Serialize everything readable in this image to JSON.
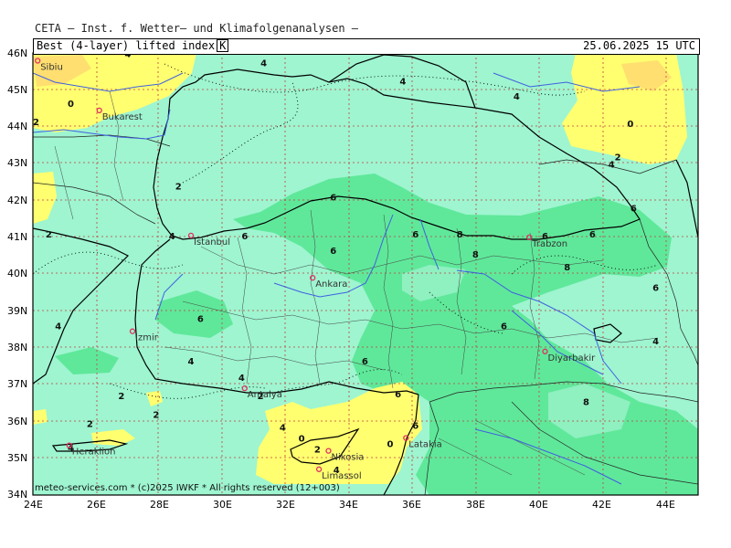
{
  "header": {
    "model_title": "CETA — Inst. f. Wetter— und Klimafolgenanalysen —",
    "parameter": "Best (4-layer) lifted index",
    "unit": "K",
    "datetime": "25.06.2025 15 UTC"
  },
  "footer": {
    "credit": "meteo-services.com * (c)2025 IWKF * All rights reserved (12+003)"
  },
  "colors": {
    "ocean_fill": "#9ef5d0",
    "lifted_green": "#5fe89a",
    "lifted_yellow": "#ffff70",
    "lifted_orange": "#ffdf70",
    "coast_line": "#000000",
    "river_line": "#4060e0",
    "grid_line": "#c04040",
    "city_marker": "#e03060"
  },
  "axes": {
    "lat_labels": [
      "46N",
      "45N",
      "44N",
      "43N",
      "42N",
      "41N",
      "40N",
      "39N",
      "38N",
      "37N",
      "36N",
      "35N",
      "34N"
    ],
    "lon_labels": [
      "24E",
      "26E",
      "28E",
      "30E",
      "32E",
      "34E",
      "36E",
      "38E",
      "40E",
      "42E",
      "44E"
    ]
  },
  "cities": [
    {
      "name": "Sibiu",
      "lon": 24.15,
      "lat": 45.8
    },
    {
      "name": "Bukarest",
      "lon": 26.1,
      "lat": 44.45
    },
    {
      "name": "Istanbul",
      "lon": 29.0,
      "lat": 41.05
    },
    {
      "name": "Ankara",
      "lon": 32.85,
      "lat": 39.9
    },
    {
      "name": "Izmir",
      "lon": 27.15,
      "lat": 38.45
    },
    {
      "name": "Antalya",
      "lon": 30.7,
      "lat": 36.9
    },
    {
      "name": "Trabzon",
      "lon": 39.7,
      "lat": 41.0
    },
    {
      "name": "Diyarbakir",
      "lon": 40.2,
      "lat": 37.9
    },
    {
      "name": "Latakia",
      "lon": 35.8,
      "lat": 35.55
    },
    {
      "name": "Nikosia",
      "lon": 33.35,
      "lat": 35.2
    },
    {
      "name": "Limassol",
      "lon": 33.05,
      "lat": 34.7
    },
    {
      "name": "Heraklion",
      "lon": 25.15,
      "lat": 35.35
    }
  ],
  "contour_labels": [
    {
      "value": "4",
      "lon": 27.0,
      "lat": 45.9
    },
    {
      "value": "4",
      "lon": 31.3,
      "lat": 45.65
    },
    {
      "value": "4",
      "lon": 35.7,
      "lat": 45.15
    },
    {
      "value": "4",
      "lon": 39.3,
      "lat": 44.75
    },
    {
      "value": "0",
      "lon": 25.2,
      "lat": 44.55
    },
    {
      "value": "0",
      "lon": 42.9,
      "lat": 44.0
    },
    {
      "value": "2",
      "lon": 24.1,
      "lat": 44.05
    },
    {
      "value": "2",
      "lon": 42.5,
      "lat": 43.1
    },
    {
      "value": "4",
      "lon": 42.3,
      "lat": 42.9
    },
    {
      "value": "2",
      "lon": 28.6,
      "lat": 42.3
    },
    {
      "value": "6",
      "lon": 33.5,
      "lat": 42.0
    },
    {
      "value": "6",
      "lon": 43.0,
      "lat": 41.7
    },
    {
      "value": "2",
      "lon": 24.5,
      "lat": 41.0
    },
    {
      "value": "4",
      "lon": 28.4,
      "lat": 40.95
    },
    {
      "value": "6",
      "lon": 30.7,
      "lat": 40.95
    },
    {
      "value": "6",
      "lon": 36.1,
      "lat": 41.0
    },
    {
      "value": "8",
      "lon": 37.5,
      "lat": 41.0
    },
    {
      "value": "6",
      "lon": 40.2,
      "lat": 40.95
    },
    {
      "value": "6",
      "lon": 41.7,
      "lat": 41.0
    },
    {
      "value": "6",
      "lon": 33.5,
      "lat": 40.55
    },
    {
      "value": "8",
      "lon": 38.0,
      "lat": 40.45
    },
    {
      "value": "8",
      "lon": 40.9,
      "lat": 40.1
    },
    {
      "value": "6",
      "lon": 43.7,
      "lat": 39.55
    },
    {
      "value": "6",
      "lon": 29.3,
      "lat": 38.7
    },
    {
      "value": "4",
      "lon": 24.8,
      "lat": 38.5
    },
    {
      "value": "6",
      "lon": 38.9,
      "lat": 38.5
    },
    {
      "value": "4",
      "lon": 43.7,
      "lat": 38.1
    },
    {
      "value": "4",
      "lon": 29.0,
      "lat": 37.55
    },
    {
      "value": "6",
      "lon": 34.5,
      "lat": 37.55
    },
    {
      "value": "4",
      "lon": 30.6,
      "lat": 37.1
    },
    {
      "value": "2",
      "lon": 26.8,
      "lat": 36.6
    },
    {
      "value": "2",
      "lon": 31.2,
      "lat": 36.6
    },
    {
      "value": "6",
      "lon": 35.55,
      "lat": 36.65
    },
    {
      "value": "8",
      "lon": 41.5,
      "lat": 36.45
    },
    {
      "value": "2",
      "lon": 27.9,
      "lat": 36.1
    },
    {
      "value": "2",
      "lon": 25.8,
      "lat": 35.85
    },
    {
      "value": "6",
      "lon": 36.1,
      "lat": 35.8
    },
    {
      "value": "4",
      "lon": 31.9,
      "lat": 35.75
    },
    {
      "value": "0",
      "lon": 32.5,
      "lat": 35.45
    },
    {
      "value": "0",
      "lon": 35.3,
      "lat": 35.3
    },
    {
      "value": "2",
      "lon": 33.0,
      "lat": 35.15
    },
    {
      "value": "4",
      "lon": 25.2,
      "lat": 35.2
    },
    {
      "value": "4",
      "lon": 33.6,
      "lat": 34.6
    }
  ]
}
